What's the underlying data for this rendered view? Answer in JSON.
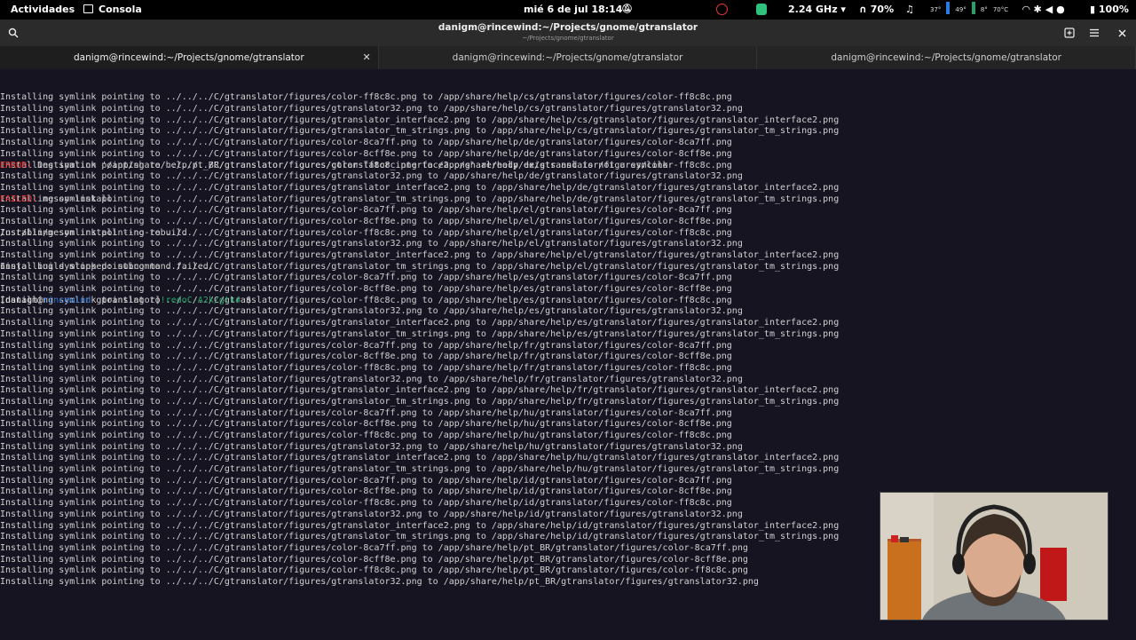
{
  "topbar": {
    "activities": "Actividades",
    "app_name": "Consola",
    "clock": "mié  6 de jul  18:14",
    "cpu_freq": "2.24 GHz ▾",
    "headset_level": "70%",
    "sysmon": [
      "37°",
      "49°",
      "8°",
      "70°C"
    ],
    "battery": "100%",
    "colors": {
      "ubuntu": "#e33333",
      "green_app": "#2ec27e"
    }
  },
  "headerbar": {
    "title": "danigm@rincewind:~/Projects/gnome/gtranslator",
    "subtitle": "~/Projects/gnome/gtranslator"
  },
  "tabs": [
    {
      "label": "danigm@rincewind:~/Projects/gnome/gtranslator",
      "active": true
    },
    {
      "label": "danigm@rincewind:~/Projects/gnome/gtranslator",
      "active": false
    },
    {
      "label": "danigm@rincewind:~/Projects/gnome/gtranslator",
      "active": false
    }
  ],
  "terminal": {
    "lines": [
      "Installing symlink pointing to ../../../C/gtranslator/figures/color-ff8c8c.png to /app/share/help/cs/gtranslator/figures/color-ff8c8c.png",
      "Installing symlink pointing to ../../../C/gtranslator/figures/gtranslator32.png to /app/share/help/cs/gtranslator/figures/gtranslator32.png",
      "Installing symlink pointing to ../../../C/gtranslator/figures/gtranslator_interface2.png to /app/share/help/cs/gtranslator/figures/gtranslator_interface2.png",
      "Installing symlink pointing to ../../../C/gtranslator/figures/gtranslator_tm_strings.png to /app/share/help/cs/gtranslator/figures/gtranslator_tm_strings.png",
      "Installing symlink pointing to ../../../C/gtranslator/figures/color-8ca7ff.png to /app/share/help/de/gtranslator/figures/color-8ca7ff.png",
      "Installing symlink pointing to ../../../C/gtranslator/figures/color-8cff8e.png to /app/share/help/de/gtranslator/figures/color-8cff8e.png",
      "Installing symlink pointing to ../../../C/gtranslator/figures/color-ff8c8c.png to /app/share/help/de/gtranslator/figures/color-ff8c8c.png",
      "Installing symlink pointing to ../../../C/gtranslator/figures/gtranslator32.png to /app/share/help/de/gtranslator/figures/gtranslator32.png",
      "Installing symlink pointing to ../../../C/gtranslator/figures/gtranslator_interface2.png to /app/share/help/de/gtranslator/figures/gtranslator_interface2.png",
      "Installing symlink pointing to ../../../C/gtranslator/figures/gtranslator_tm_strings.png to /app/share/help/de/gtranslator/figures/gtranslator_tm_strings.png",
      "Installing symlink pointing to ../../../C/gtranslator/figures/color-8ca7ff.png to /app/share/help/el/gtranslator/figures/color-8ca7ff.png",
      "Installing symlink pointing to ../../../C/gtranslator/figures/color-8cff8e.png to /app/share/help/el/gtranslator/figures/color-8cff8e.png",
      "Installing symlink pointing to ../../../C/gtranslator/figures/color-ff8c8c.png to /app/share/help/el/gtranslator/figures/color-ff8c8c.png",
      "Installing symlink pointing to ../../../C/gtranslator/figures/gtranslator32.png to /app/share/help/el/gtranslator/figures/gtranslator32.png",
      "Installing symlink pointing to ../../../C/gtranslator/figures/gtranslator_interface2.png to /app/share/help/el/gtranslator/figures/gtranslator_interface2.png",
      "Installing symlink pointing to ../../../C/gtranslator/figures/gtranslator_tm_strings.png to /app/share/help/el/gtranslator/figures/gtranslator_tm_strings.png",
      "Installing symlink pointing to ../../../C/gtranslator/figures/color-8ca7ff.png to /app/share/help/es/gtranslator/figures/color-8ca7ff.png",
      "Installing symlink pointing to ../../../C/gtranslator/figures/color-8cff8e.png to /app/share/help/es/gtranslator/figures/color-8cff8e.png",
      "Installing symlink pointing to ../../../C/gtranslator/figures/color-ff8c8c.png to /app/share/help/es/gtranslator/figures/color-ff8c8c.png",
      "Installing symlink pointing to ../../../C/gtranslator/figures/gtranslator32.png to /app/share/help/es/gtranslator/figures/gtranslator32.png",
      "Installing symlink pointing to ../../../C/gtranslator/figures/gtranslator_interface2.png to /app/share/help/es/gtranslator/figures/gtranslator_interface2.png",
      "Installing symlink pointing to ../../../C/gtranslator/figures/gtranslator_tm_strings.png to /app/share/help/es/gtranslator/figures/gtranslator_tm_strings.png",
      "Installing symlink pointing to ../../../C/gtranslator/figures/color-8ca7ff.png to /app/share/help/fr/gtranslator/figures/color-8ca7ff.png",
      "Installing symlink pointing to ../../../C/gtranslator/figures/color-8cff8e.png to /app/share/help/fr/gtranslator/figures/color-8cff8e.png",
      "Installing symlink pointing to ../../../C/gtranslator/figures/color-ff8c8c.png to /app/share/help/fr/gtranslator/figures/color-ff8c8c.png",
      "Installing symlink pointing to ../../../C/gtranslator/figures/gtranslator32.png to /app/share/help/fr/gtranslator/figures/gtranslator32.png",
      "Installing symlink pointing to ../../../C/gtranslator/figures/gtranslator_interface2.png to /app/share/help/fr/gtranslator/figures/gtranslator_interface2.png",
      "Installing symlink pointing to ../../../C/gtranslator/figures/gtranslator_tm_strings.png to /app/share/help/fr/gtranslator/figures/gtranslator_tm_strings.png",
      "Installing symlink pointing to ../../../C/gtranslator/figures/color-8ca7ff.png to /app/share/help/hu/gtranslator/figures/color-8ca7ff.png",
      "Installing symlink pointing to ../../../C/gtranslator/figures/color-8cff8e.png to /app/share/help/hu/gtranslator/figures/color-8cff8e.png",
      "Installing symlink pointing to ../../../C/gtranslator/figures/color-ff8c8c.png to /app/share/help/hu/gtranslator/figures/color-ff8c8c.png",
      "Installing symlink pointing to ../../../C/gtranslator/figures/gtranslator32.png to /app/share/help/hu/gtranslator/figures/gtranslator32.png",
      "Installing symlink pointing to ../../../C/gtranslator/figures/gtranslator_interface2.png to /app/share/help/hu/gtranslator/figures/gtranslator_interface2.png",
      "Installing symlink pointing to ../../../C/gtranslator/figures/gtranslator_tm_strings.png to /app/share/help/hu/gtranslator/figures/gtranslator_tm_strings.png",
      "Installing symlink pointing to ../../../C/gtranslator/figures/color-8ca7ff.png to /app/share/help/id/gtranslator/figures/color-8ca7ff.png",
      "Installing symlink pointing to ../../../C/gtranslator/figures/color-8cff8e.png to /app/share/help/id/gtranslator/figures/color-8cff8e.png",
      "Installing symlink pointing to ../../../C/gtranslator/figures/color-ff8c8c.png to /app/share/help/id/gtranslator/figures/color-ff8c8c.png",
      "Installing symlink pointing to ../../../C/gtranslator/figures/gtranslator32.png to /app/share/help/id/gtranslator/figures/gtranslator32.png",
      "Installing symlink pointing to ../../../C/gtranslator/figures/gtranslator_interface2.png to /app/share/help/id/gtranslator/figures/gtranslator_interface2.png",
      "Installing symlink pointing to ../../../C/gtranslator/figures/gtranslator_tm_strings.png to /app/share/help/id/gtranslator/figures/gtranslator_tm_strings.png",
      "Installing symlink pointing to ../../../C/gtranslator/figures/color-8ca7ff.png to /app/share/help/pt_BR/gtranslator/figures/color-8ca7ff.png",
      "Installing symlink pointing to ../../../C/gtranslator/figures/color-8cff8e.png to /app/share/help/pt_BR/gtranslator/figures/color-8cff8e.png",
      "Installing symlink pointing to ../../../C/gtranslator/figures/color-ff8c8c.png to /app/share/help/pt_BR/gtranslator/figures/color-ff8c8c.png",
      "Installing symlink pointing to ../../../C/gtranslator/figures/gtranslator32.png to /app/share/help/pt_BR/gtranslator/figures/gtranslator32.png"
    ],
    "error_label": "ERROR:",
    "error_text": " Destination '/app/share/help/pt_BR/gtranslator/figures/gtranslator_interface2.png' already exists and is not a symlink",
    "failed_label": "FAILED:",
    "failed_text": " meson-install",
    "cmd_line": "/usr/bin/meson install --no-rebuild",
    "ninja_line": "ninja: build stopped: subcommand failed.",
    "prompt": {
      "open": "[",
      "user": "danigm",
      "at": "@",
      "host": "rincewind",
      "dir": " gtranslator]",
      "branch": "!redoC-A2k/gtk4",
      "symbol": " $"
    },
    "colors": {
      "background": "#171421",
      "error": "#f03232",
      "host": "#2a7bde",
      "branch": "#26a269"
    }
  }
}
